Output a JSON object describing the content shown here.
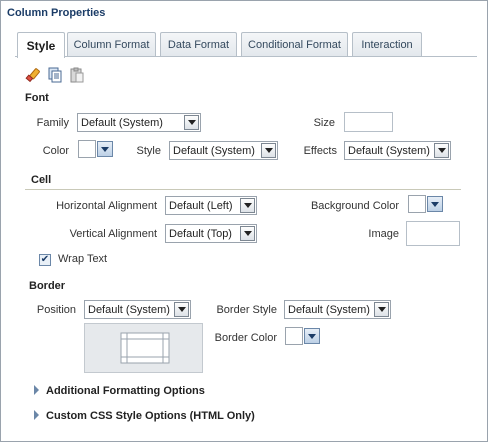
{
  "title": "Column Properties",
  "tabs": [
    {
      "label": "Style"
    },
    {
      "label": "Column Format"
    },
    {
      "label": "Data Format"
    },
    {
      "label": "Conditional Format"
    },
    {
      "label": "Interaction"
    }
  ],
  "toolbar": {
    "icons": [
      "clear-format-icon",
      "copy-icon",
      "paste-icon"
    ]
  },
  "font": {
    "heading": "Font",
    "family_label": "Family",
    "family_value": "Default (System)",
    "size_label": "Size",
    "size_value": "",
    "color_label": "Color",
    "style_label": "Style",
    "style_value": "Default (System)",
    "effects_label": "Effects",
    "effects_value": "Default (System)"
  },
  "cell": {
    "heading": "Cell",
    "halign_label": "Horizontal Alignment",
    "halign_value": "Default (Left)",
    "bgcolor_label": "Background Color",
    "valign_label": "Vertical Alignment",
    "valign_value": "Default (Top)",
    "image_label": "Image",
    "wrap_label": "Wrap Text",
    "wrap_checked": true
  },
  "border": {
    "heading": "Border",
    "position_label": "Position",
    "position_value": "Default (System)",
    "style_label": "Border Style",
    "style_value": "Default (System)",
    "color_label": "Border Color"
  },
  "expanders": [
    {
      "label": "Additional Formatting Options"
    },
    {
      "label": "Custom CSS Style Options (HTML Only)"
    }
  ],
  "colors": {
    "title": "#1b3c67",
    "tab_border": "#b6bfc8",
    "accent": "#6b87a8"
  }
}
